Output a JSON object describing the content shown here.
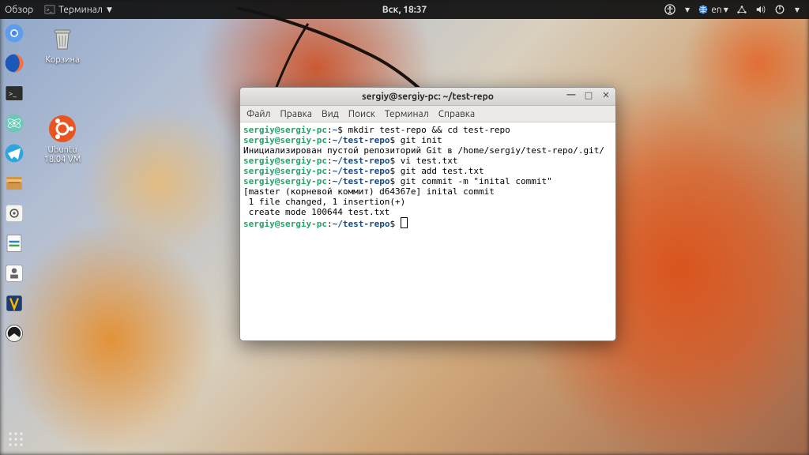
{
  "topbar": {
    "activities": "Обзор",
    "app_indicator": "Терминал",
    "clock": "Вск, 18:37",
    "lang": "en"
  },
  "desktop": {
    "trash_label": "Корзина",
    "ubuntu_label": "Ubuntu 18.04 VM"
  },
  "window": {
    "title": "sergiy@sergiy-pc: ~/test-repo",
    "menu": {
      "file": "Файл",
      "edit": "Правка",
      "view": "Вид",
      "search": "Поиск",
      "terminal": "Терминал",
      "help": "Справка"
    }
  },
  "terminal": {
    "user_host": "sergiy@sergiy-pc",
    "home_prompt": "~",
    "repo_prompt": "~/test-repo",
    "cmd1": "mkdir test-repo && cd test-repo",
    "cmd2": "git init",
    "out2": "Инициализирован пустой репозиторий Git в /home/sergiy/test-repo/.git/",
    "cmd3": "vi test.txt",
    "cmd4": "git add test.txt",
    "cmd5": "git commit -m \"inital commit\"",
    "out5a": "[master (корневой коммит) d64367e] inital commit",
    "out5b": " 1 file changed, 1 insertion(+)",
    "out5c": " create mode 100644 test.txt"
  }
}
